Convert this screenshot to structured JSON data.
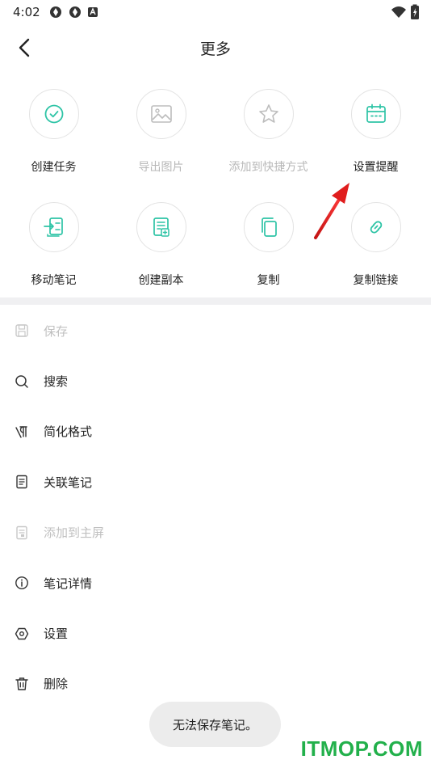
{
  "status_bar": {
    "time": "4:02",
    "icons": [
      "notification-icon",
      "notification-icon",
      "app-icon",
      "wifi-icon",
      "battery-icon"
    ]
  },
  "header": {
    "title": "更多",
    "back_icon": "chevron-left-icon"
  },
  "grid": {
    "items": [
      {
        "label": "创建任务",
        "icon": "check-circle-icon",
        "enabled": true
      },
      {
        "label": "导出图片",
        "icon": "image-icon",
        "enabled": false
      },
      {
        "label": "添加到快捷方式",
        "icon": "star-icon",
        "enabled": false
      },
      {
        "label": "设置提醒",
        "icon": "calendar-icon",
        "enabled": true
      },
      {
        "label": "移动笔记",
        "icon": "move-note-icon",
        "enabled": true
      },
      {
        "label": "创建副本",
        "icon": "duplicate-icon",
        "enabled": true
      },
      {
        "label": "复制",
        "icon": "copy-icon",
        "enabled": true
      },
      {
        "label": "复制链接",
        "icon": "link-icon",
        "enabled": true
      }
    ]
  },
  "menu": {
    "items": [
      {
        "label": "保存",
        "icon": "save-icon",
        "enabled": false
      },
      {
        "label": "搜索",
        "icon": "search-icon",
        "enabled": true
      },
      {
        "label": "简化格式",
        "icon": "clear-format-icon",
        "enabled": true
      },
      {
        "label": "关联笔记",
        "icon": "linked-note-icon",
        "enabled": true
      },
      {
        "label": "添加到主屏",
        "icon": "home-screen-icon",
        "enabled": false
      },
      {
        "label": "笔记详情",
        "icon": "info-icon",
        "enabled": true
      },
      {
        "label": "设置",
        "icon": "settings-icon",
        "enabled": true
      },
      {
        "label": "删除",
        "icon": "trash-icon",
        "enabled": true
      }
    ]
  },
  "toast": {
    "message": "无法保存笔记。"
  },
  "watermark": {
    "text": "ITMOP.COM"
  },
  "colors": {
    "accent": "#2ec4a6",
    "disabled": "#c0c0c0",
    "divider": "#f0f0f2",
    "arrow": "#e01d1d",
    "watermark": "#22b04b"
  }
}
